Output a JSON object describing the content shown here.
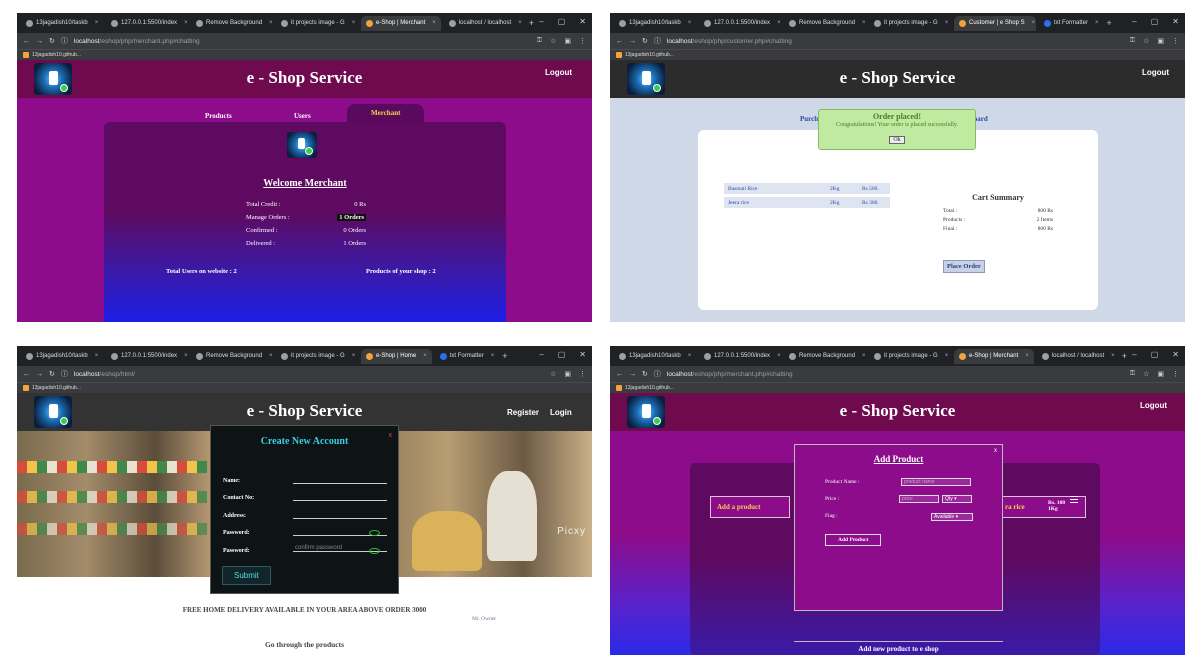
{
  "common": {
    "brand": "e - Shop Service",
    "bookmark": "13jagadish10.github..."
  },
  "s1": {
    "tabs": [
      "13jagadish10/taskb",
      "127.0.0.1:5500/index",
      "Remove Background",
      "it projects image - G",
      "e-Shop | Merchant",
      "localhost / localhost"
    ],
    "url_host": "localhost",
    "url_path": "/eshop/php/merchant.php#chatting",
    "logout": "Logout",
    "nav": {
      "products": "Products",
      "users": "Users",
      "merchant": "Merchant"
    },
    "welcome": "Welcome Merchant",
    "stats": [
      {
        "label": "Total Credit :",
        "value": "0 Rs"
      },
      {
        "label": "Manage Orders :",
        "value": "1 Orders"
      },
      {
        "label": "Confirmed :",
        "value": "0 Orders"
      },
      {
        "label": "Delivered :",
        "value": "1 Orders"
      }
    ],
    "users_on_site": "Total Users on website : 2",
    "products_of_shop": "Products of your shop : 2"
  },
  "s2": {
    "tabs": [
      "13jagadish10/taskb",
      "127.0.0.1:5500/index",
      "Remove Background",
      "it projects image - G",
      "Customer | e Shop S",
      "txt Formatter"
    ],
    "url_host": "localhost",
    "url_path": "/eshop/php/customer.php#chatting",
    "logout": "Logout",
    "menu_left": "Purch",
    "menu_right": "hboard",
    "alert_title": "Order placed!",
    "alert_text": "Congratulations! Your order is placed successfully.",
    "alert_ok": "Ok",
    "items": [
      {
        "name": "Basmati Rice",
        "qty": "2Kg",
        "price": "Rs 500."
      },
      {
        "name": "Jeera rice",
        "qty": "2Kg",
        "price": "Rs 300."
      }
    ],
    "cart_title": "Cart Summary",
    "cart": [
      {
        "label": "Total :",
        "value": "800 Rs"
      },
      {
        "label": "Products :",
        "value": "2 Items"
      },
      {
        "label": "Final :",
        "value": "800 Rs"
      }
    ],
    "place_order": "Place Order"
  },
  "s3": {
    "tabs": [
      "13jagadish10/taskb",
      "127.0.0.1:5500/index",
      "Remove Background",
      "it projects image - G",
      "e-Shop | Home",
      "txt Formatter"
    ],
    "url_host": "localhost",
    "url_path": "/eshop/html/",
    "register": "Register",
    "login": "Login",
    "modal_title": "Create New Account",
    "close": "x",
    "fields": {
      "name": "Name:",
      "contact": "Contact No:",
      "address": "Address:",
      "password": "Password:",
      "password2": "Password:"
    },
    "confirm_placeholder": "confirm password",
    "submit": "Submit",
    "watermark": "Picxy",
    "free_delivery": "FREE HOME DELIVERY AVAILABLE IN YOUR AREA ABOVE ORDER 3000",
    "owner": "Mr. Owner",
    "go_through": "Go through the products"
  },
  "s4": {
    "tabs": [
      "13jagadish10/taskb",
      "127.0.0.1:5500/index",
      "Remove Background",
      "it projects image - G",
      "e-Shop | Merchant",
      "localhost / localhost"
    ],
    "url_host": "localhost",
    "url_path": "/eshop/php/merchant.php#chatting",
    "logout": "Logout",
    "modal_title": "Add Product",
    "close": "x",
    "product_name_label": "Product Name :",
    "product_name_placeholder": "product name",
    "price_label": "Price :",
    "price_placeholder": "price",
    "qty_option": "Qty",
    "flag_label": "Flag :",
    "flag_option": "Available",
    "add_button": "Add Product",
    "footer": "Add new product to e shop",
    "add_a_product": "Add a product",
    "strip_right": "ra rice",
    "price_tag_1": "Rs. 100",
    "price_tag_2": "1Kg"
  }
}
